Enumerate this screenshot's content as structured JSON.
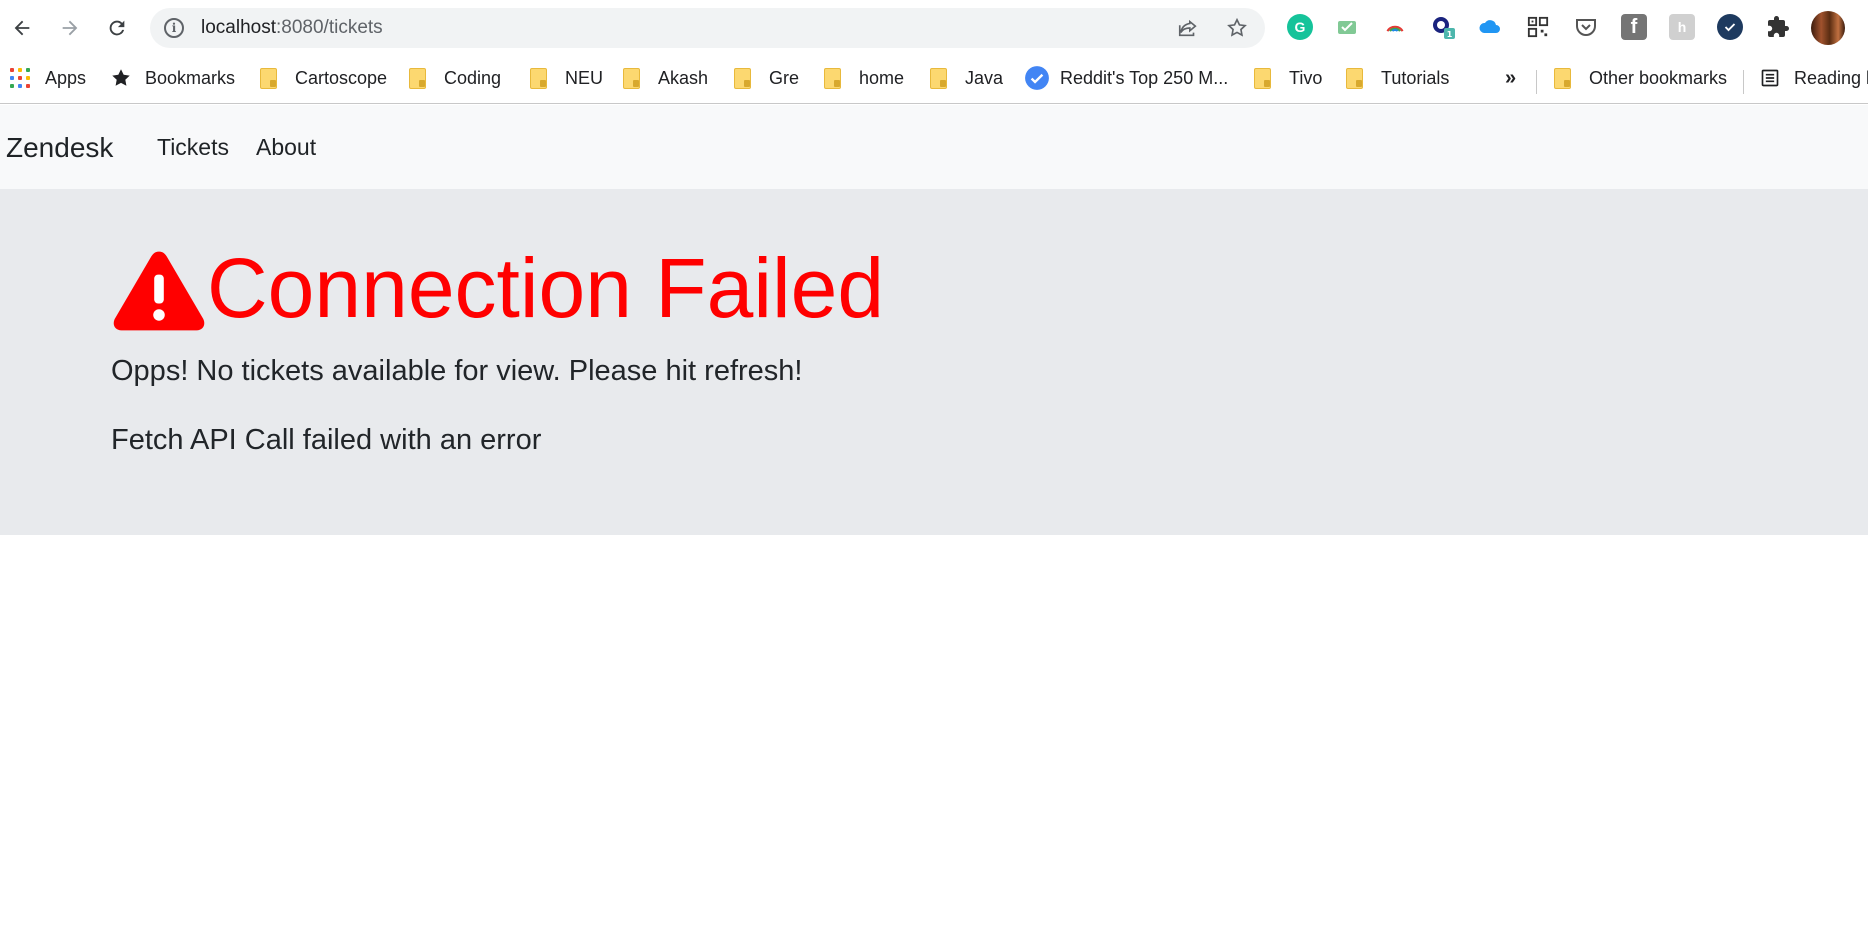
{
  "browser": {
    "url_host": "localhost",
    "url_path": ":8080/tickets",
    "extensions": [
      "grammarly-icon",
      "mail-tracker-icon",
      "rainbow-icon",
      "keyword-icon",
      "onedrive-icon",
      "qr-code-icon",
      "pocket-icon",
      "facebook-icon",
      "hootsuite-icon",
      "check-icon",
      "puzzle-icon",
      "profile-avatar"
    ]
  },
  "bookmarks": {
    "apps": "Apps",
    "bookmarks": "Bookmarks",
    "items": [
      "Cartoscope",
      "Coding",
      "NEU",
      "Akash",
      "Gre",
      "home",
      "Java"
    ],
    "reddit": "Reddit's Top 250 M...",
    "items2": [
      "Tivo",
      "Tutorials"
    ],
    "overflow": "»",
    "other": "Other bookmarks",
    "reading": "Reading l"
  },
  "navbar": {
    "brand": "Zendesk",
    "links": [
      "Tickets",
      "About"
    ]
  },
  "error": {
    "title": "Connection Failed",
    "message": "Opps! No tickets available for view. Please hit refresh!",
    "detail": "Fetch API Call failed with an error",
    "color": "#ff0000"
  }
}
